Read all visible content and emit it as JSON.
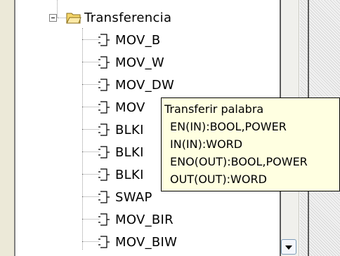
{
  "tree": {
    "folder": {
      "label": "Transferencia",
      "icon": "open-folder-icon",
      "state": "expanded"
    },
    "items": [
      {
        "label": "MOV_B",
        "icon": "function-block-icon"
      },
      {
        "label": "MOV_W",
        "icon": "function-block-icon"
      },
      {
        "label": "MOV_DW",
        "icon": "function-block-icon"
      },
      {
        "label": "MOV",
        "icon": "function-block-icon"
      },
      {
        "label": "BLKI",
        "icon": "function-block-icon"
      },
      {
        "label": "BLKI",
        "icon": "function-block-icon"
      },
      {
        "label": "BLKI",
        "icon": "function-block-icon"
      },
      {
        "label": "SWAP",
        "icon": "function-block-icon"
      },
      {
        "label": "MOV_BIR",
        "icon": "function-block-icon"
      },
      {
        "label": "MOV_BIW",
        "icon": "function-block-icon"
      }
    ]
  },
  "tooltip": {
    "title": "Transferir palabra",
    "lines": [
      "EN(IN):BOOL,POWER",
      "IN(IN):WORD",
      "ENO(OUT):BOOL,POWER",
      "OUT(OUT):WORD"
    ]
  },
  "scrollbar": {
    "down_icon": "chevron-down-icon"
  },
  "colors": {
    "tooltip_bg": "#ffffe1",
    "folder": "#f5d66b",
    "window_bg": "#ece9d8"
  }
}
